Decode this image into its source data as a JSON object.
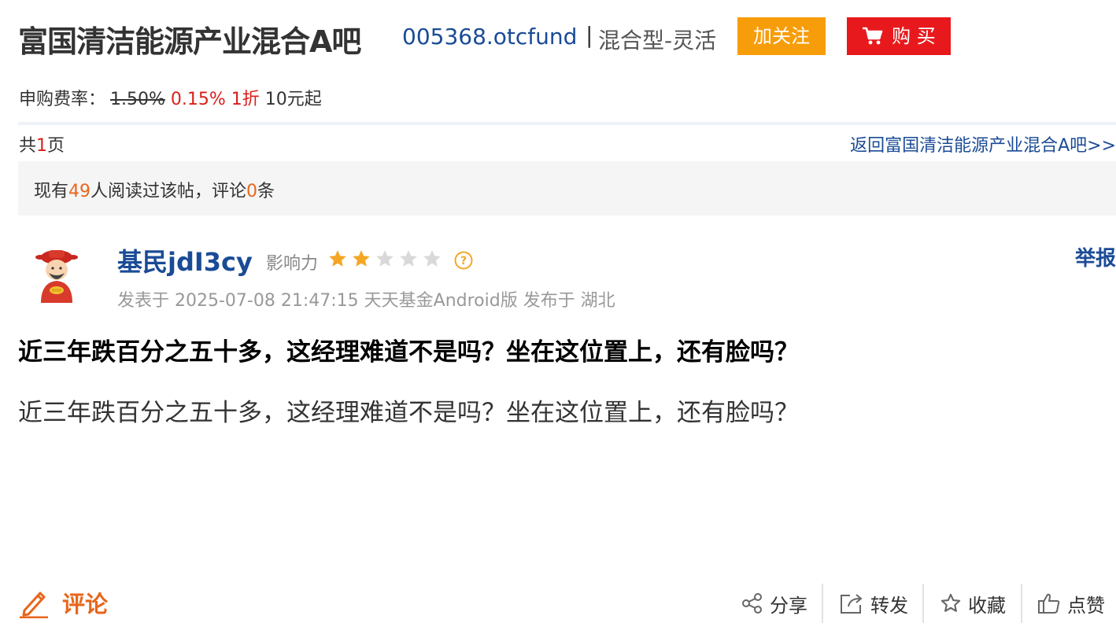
{
  "header": {
    "bar_title": "富国清洁能源产业混合A吧",
    "fund_code": "005368.otcfund",
    "separator": "|",
    "fund_type": "混合型-灵活",
    "follow_label": "加关注",
    "buy_label": "购 买"
  },
  "fee": {
    "label": "申购费率：",
    "original_rate": "1.50%",
    "discount_rate": "0.15%",
    "discount": "1折",
    "minimum": "10元起"
  },
  "pager": {
    "prefix": "共",
    "pages": "1",
    "suffix": "页",
    "back_link": "返回富国清洁能源产业混合A吧>>"
  },
  "stats": {
    "prefix": "现有",
    "readers": "49",
    "middle": "人阅读过该帖，评论",
    "comments": "0",
    "suffix": "条"
  },
  "author": {
    "name": "基民jdI3cy",
    "influence_label": "影响力",
    "influence_stars": 2,
    "max_stars": 5,
    "report_label": "举报",
    "meta": "发表于 2025-07-08 21:47:15 天天基金Android版 发布于 湖北"
  },
  "post": {
    "title": "近三年跌百分之五十多，这经理难道不是吗？坐在这位置上，还有脸吗？",
    "body": "近三年跌百分之五十多，这经理难道不是吗？坐在这位置上，还有脸吗？"
  },
  "footer": {
    "comment_label": "评论",
    "share_label": "分享",
    "forward_label": "转发",
    "favorite_label": "收藏",
    "like_label": "点赞"
  },
  "colors": {
    "link_blue": "#1a4b96",
    "orange": "#f79d0a",
    "red": "#e8191d",
    "accent_orange": "#e8661b",
    "star_gold": "#f5a623",
    "star_grey": "#d9d9d9"
  }
}
